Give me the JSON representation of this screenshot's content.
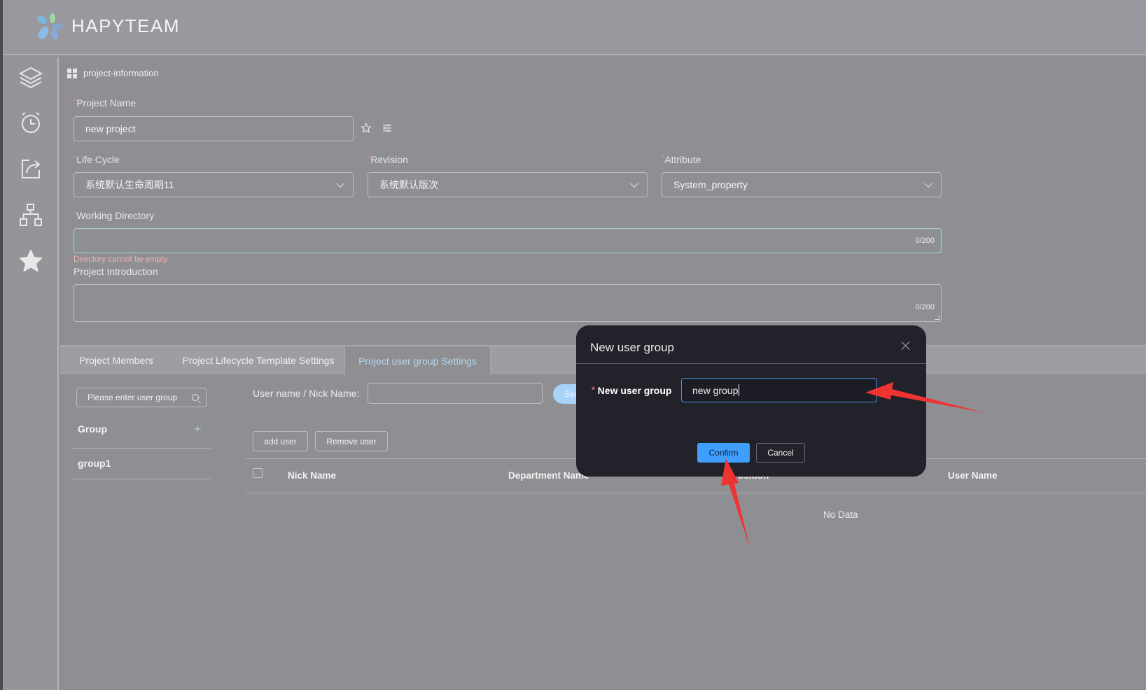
{
  "app": {
    "brand": "HAPYTEAM"
  },
  "sidebar": {
    "items": [
      {
        "icon": "layers-icon"
      },
      {
        "icon": "alarm-clock-icon"
      },
      {
        "icon": "share-icon"
      },
      {
        "icon": "hierarchy-icon"
      },
      {
        "icon": "star-icon"
      }
    ]
  },
  "breadcrumb": {
    "label": "project-information"
  },
  "form": {
    "project_name": {
      "label": "Project Name",
      "required": "*",
      "value": "new project"
    },
    "life_cycle": {
      "label": "Life Cycle",
      "required": "*",
      "value": "系统默认生命周期11"
    },
    "revision": {
      "label": "Revision",
      "required": "*",
      "value": "系统默认版次"
    },
    "attribute": {
      "label": "Attribute",
      "required": "*",
      "value": "System_property"
    },
    "working_directory": {
      "label": "Working Directory",
      "required": "*",
      "value": "",
      "counter": "0/200",
      "error": "Directory cannot be empty"
    },
    "project_introduction": {
      "label": "Project Introduction",
      "value": "",
      "counter": "0/200"
    }
  },
  "tabs": [
    {
      "label": "Project Members",
      "active": false
    },
    {
      "label": "Project Lifecycle Template Settings",
      "active": false
    },
    {
      "label": "Project user group Settings",
      "active": true
    }
  ],
  "groups_panel": {
    "search_placeholder": "Please enter user group",
    "heading": "Group",
    "add_icon": "+",
    "items": [
      "group1"
    ]
  },
  "members_panel": {
    "filter_label": "User name / Nick Name:",
    "filter_value": "",
    "search_label": "Search",
    "add_user_label": "add user",
    "remove_user_label": "Remove user",
    "columns": [
      "Nick Name",
      "Department Name",
      "Position",
      "User Name"
    ],
    "rows": [],
    "empty_text": "No Data"
  },
  "modal": {
    "title": "New user group",
    "field_label": "New user group",
    "required": "*",
    "field_value": "new group",
    "confirm_label": "Confirm",
    "cancel_label": "Cancel"
  },
  "colors": {
    "accent": "#409eff",
    "active_tab": "#b3d8ec",
    "error": "#e9b4b5",
    "annotation_arrow": "#ee3333"
  }
}
